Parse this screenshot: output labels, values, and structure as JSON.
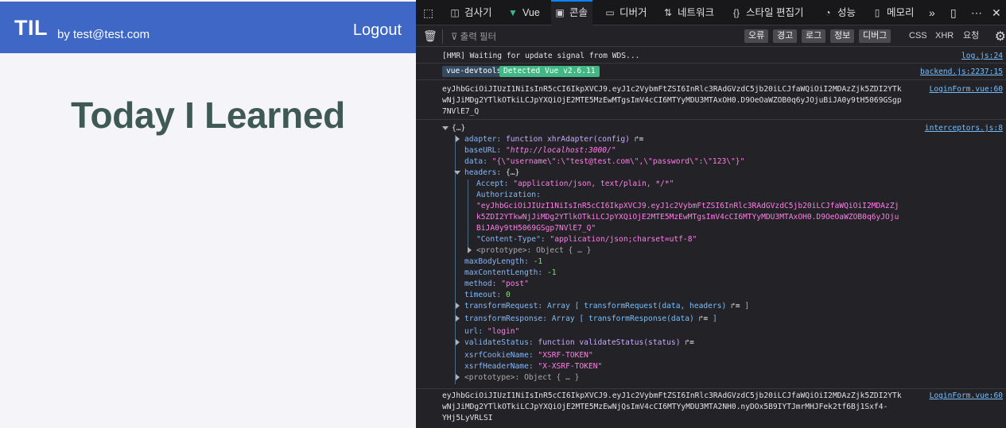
{
  "app": {
    "logo": "TIL",
    "user": "by test@test.com",
    "logout": "Logout",
    "title": "Today I Learned"
  },
  "devtools": {
    "tabs": [
      {
        "label": "검사기",
        "icon": "inspector-icon"
      },
      {
        "label": "Vue",
        "icon": "vue-logo-icon"
      },
      {
        "label": "콘솔",
        "icon": "console-icon"
      },
      {
        "label": "디버거",
        "icon": "debugger-icon"
      },
      {
        "label": "네트워크",
        "icon": "network-icon"
      },
      {
        "label": "스타일 편집기",
        "icon": "style-editor-icon"
      },
      {
        "label": "성능",
        "icon": "performance-icon"
      },
      {
        "label": "메모리",
        "icon": "memory-icon"
      }
    ],
    "active_tab": "콘솔",
    "filter_placeholder": "출력 필터",
    "levels": [
      "오류",
      "경고",
      "로그",
      "정보",
      "디버그"
    ],
    "extra_filters": [
      "CSS",
      "XHR",
      "요청"
    ]
  },
  "console": {
    "hmr": {
      "text": "[HMR] Waiting for update signal from WDS...",
      "source": "log.js:24"
    },
    "vue": {
      "badge_a": "vue-devtools",
      "badge_b": "Detected Vue v2.6.11",
      "source": "backend.js:2237:15"
    },
    "token1": {
      "lines": [
        "eyJhbGciOiJIUzI1NiIsInR5cCI6IkpXVCJ9.eyJ1c2VybmFtZSI6InRlc3RAdGVzdC5jb20iLCJfaWQiOiI2MDAzZjk5ZDI2YTk",
        "wNjJiMDg2YTlkOTkiLCJpYXQiOjE2MTE5MzEwMTgsImV4cCI6MTYyMDU3MTAxOH0.D9OeOaWZOB0q6yJOjuBiJA0y9tH5069GSgp",
        "7NVlE7_Q"
      ],
      "source": "LoginForm.vue:60"
    },
    "object": {
      "source": "interceptors.js:8",
      "root": "{…}",
      "adapter_key": "adapter:",
      "adapter_val": "function xhrAdapter(config)",
      "baseURL_key": "baseURL:",
      "baseURL_val": "\"http://localhost:3000/\"",
      "data_key": "data:",
      "data_val": "\"{\\\"username\\\":\\\"test@test.com\\\",\\\"password\\\":\\\"123\\\"}\"",
      "headers_key": "headers:",
      "headers_val": "{…}",
      "accept_key": "Accept:",
      "accept_val": "\"application/json, text/plain, */*\"",
      "auth_key": "Authorization:",
      "auth_lines": [
        "\"eyJhbGciOiJIUzI1NiIsInR5cCI6IkpXVCJ9.eyJ1c2VybmFtZSI6InRlc3RAdGVzdC5jb20iLCJfaWQiOiI2MDAzZj",
        "k5ZDI2YTkwNjJiMDg2YTlkOTkiLCJpYXQiOjE2MTE5MzEwMTgsImV4cCI6MTYyMDU3MTAxOH0.D9OeOaWZOB0q6yJOju",
        "BiJA0y9tH5069GSgp7NVlE7_Q\""
      ],
      "ctype_key": "\"Content-Type\":",
      "ctype_val": "\"application/json;charset=utf-8\"",
      "proto_inner": "<prototype>: Object { … }",
      "maxBody_key": "maxBodyLength:",
      "maxBody_val": "-1",
      "maxContent_key": "maxContentLength:",
      "maxContent_val": "-1",
      "method_key": "method:",
      "method_val": "\"post\"",
      "timeout_key": "timeout:",
      "timeout_val": "0",
      "treq_key": "transformRequest:",
      "treq_val": "Array [ transformRequest(data, headers)",
      "tres_key": "transformResponse:",
      "tres_val": "Array [ transformResponse(data)",
      "url_key": "url:",
      "url_val": "\"login\"",
      "validate_key": "validateStatus:",
      "validate_val": "function validateStatus(status)",
      "xsrfCookie_key": "xsrfCookieName:",
      "xsrfCookie_val": "\"XSRF-TOKEN\"",
      "xsrfHeader_key": "xsrfHeaderName:",
      "xsrfHeader_val": "\"X-XSRF-TOKEN\"",
      "proto_outer": "<prototype>: Object { … }",
      "arr_close": "]"
    },
    "token2": {
      "lines": [
        "eyJhbGciOiJIUzI1NiIsInR5cCI6IkpXVCJ9.eyJ1c2VybmFtZSI6InRlc3RAdGVzdC5jb20iLCJfaWQiOiI2MDAzZjk5ZDI2YTk",
        "wNjJiMDg2YTlkOTkiLCJpYXQiOjE2MTE5MzEwNjQsImV4cCI6MTYyMDU3MTA2NH0.nyDOx5B9IYTJmrMHJFek2tf6Bj1Sxf4-",
        "YHj5LyVRLSI"
      ],
      "source": "LoginForm.vue:60"
    }
  },
  "colors": {
    "header_blue": "#3f67c6",
    "title_green": "#3f5a54",
    "devtools_bg": "#232327",
    "vue_green": "#41b883"
  }
}
